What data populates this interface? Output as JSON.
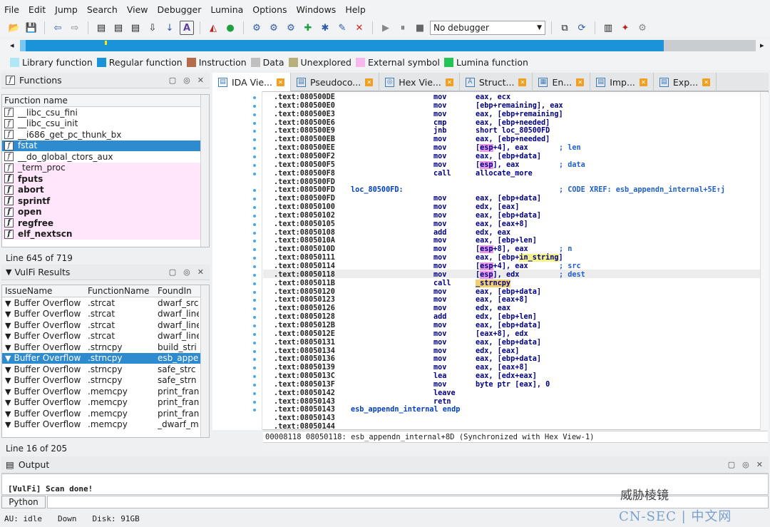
{
  "menu": [
    "File",
    "Edit",
    "Jump",
    "Search",
    "View",
    "Debugger",
    "Lumina",
    "Options",
    "Windows",
    "Help"
  ],
  "toolbar": {
    "debugger_label": "No debugger"
  },
  "legend": [
    {
      "label": "Library function",
      "color": "#aee8f6"
    },
    {
      "label": "Regular function",
      "color": "#1a93d8"
    },
    {
      "label": "Instruction",
      "color": "#b36b4a"
    },
    {
      "label": "Data",
      "color": "#c0c0c0"
    },
    {
      "label": "Unexplored",
      "color": "#b8b07a"
    },
    {
      "label": "External symbol",
      "color": "#f7b8ee"
    },
    {
      "label": "Lumina function",
      "color": "#22c455"
    }
  ],
  "functions": {
    "title": "Functions",
    "col": "Function name",
    "items": [
      "__libc_csu_fini",
      "__libc_csu_init",
      "__i686_get_pc_thunk_bx",
      "fstat",
      "__do_global_ctors_aux",
      "_term_proc",
      "fputs",
      "abort",
      "sprintf",
      "open",
      "regfree",
      "elf_nextscn"
    ],
    "status": "Line 645 of 719"
  },
  "vulfi": {
    "title": "VulFi Results",
    "cols": [
      "IssueName",
      "FunctionName",
      "FoundIn"
    ],
    "rows": [
      [
        "Buffer Overflow",
        ".strcat",
        "dwarf_src"
      ],
      [
        "Buffer Overflow",
        ".strcat",
        "dwarf_line"
      ],
      [
        "Buffer Overflow",
        ".strcat",
        "dwarf_line"
      ],
      [
        "Buffer Overflow",
        ".strcat",
        "dwarf_line"
      ],
      [
        "Buffer Overflow",
        ".strncpy",
        "build_stri"
      ],
      [
        "Buffer Overflow",
        ".strncpy",
        "esb_appe"
      ],
      [
        "Buffer Overflow",
        ".strncpy",
        "safe_strc"
      ],
      [
        "Buffer Overflow",
        ".strncpy",
        "safe_strn"
      ],
      [
        "Buffer Overflow",
        ".memcpy",
        "print_fran"
      ],
      [
        "Buffer Overflow",
        ".memcpy",
        "print_fran"
      ],
      [
        "Buffer Overflow",
        ".memcpy",
        "print_fran"
      ],
      [
        "Buffer Overflow",
        ".memcpy",
        "_dwarf_m"
      ]
    ],
    "status": "Line 16 of 205"
  },
  "tabs": [
    "IDA Vie...",
    "Pseudoco...",
    "Hex Vie...",
    "Struct...",
    "En...",
    "Imp...",
    "Exp..."
  ],
  "code": [
    {
      "a": ".text:080500DE",
      "m": "mov",
      "o": "eax, ecx"
    },
    {
      "a": ".text:080500E0",
      "m": "mov",
      "o": "[ebp+remaining], eax"
    },
    {
      "a": ".text:080500E3",
      "m": "mov",
      "o": "eax, [ebp+remaining]"
    },
    {
      "a": ".text:080500E6",
      "m": "cmp",
      "o": "eax, [ebp+needed]"
    },
    {
      "a": ".text:080500E9",
      "m": "jnb",
      "o": "short loc_80500FD"
    },
    {
      "a": ".text:080500EB",
      "m": "mov",
      "o": "eax, [ebp+needed]"
    },
    {
      "a": ".text:080500EE",
      "m": "mov",
      "o": "[esp+4], eax",
      "c": "; len"
    },
    {
      "a": ".text:080500F2",
      "m": "mov",
      "o": "eax, [ebp+data]"
    },
    {
      "a": ".text:080500F5",
      "m": "mov",
      "o": "[esp], eax",
      "c": "; data"
    },
    {
      "a": ".text:080500F8",
      "m": "call",
      "o": "allocate_more"
    },
    {
      "a": ".text:080500FD",
      "m": "",
      "o": ""
    },
    {
      "a": ".text:080500FD",
      "l": "loc_80500FD:",
      "m": "",
      "o": "",
      "c": "; CODE XREF: esb_appendn_internal+5E↑j"
    },
    {
      "a": ".text:080500FD",
      "m": "mov",
      "o": "eax, [ebp+data]"
    },
    {
      "a": ".text:08050100",
      "m": "mov",
      "o": "edx, [eax]"
    },
    {
      "a": ".text:08050102",
      "m": "mov",
      "o": "eax, [ebp+data]"
    },
    {
      "a": ".text:08050105",
      "m": "mov",
      "o": "eax, [eax+8]"
    },
    {
      "a": ".text:08050108",
      "m": "add",
      "o": "edx, eax"
    },
    {
      "a": ".text:0805010A",
      "m": "mov",
      "o": "eax, [ebp+len]"
    },
    {
      "a": ".text:0805010D",
      "m": "mov",
      "o": "[esp+8], eax",
      "c": "; n"
    },
    {
      "a": ".text:08050111",
      "m": "mov",
      "o": "eax, [ebp+in_string]"
    },
    {
      "a": ".text:08050114",
      "m": "mov",
      "o": "[esp+4], eax",
      "c": "; src"
    },
    {
      "a": ".text:08050118",
      "m": "mov",
      "o": "[esp], edx",
      "c": "; dest"
    },
    {
      "a": ".text:0805011B",
      "m": "call",
      "o": "_strncpy"
    },
    {
      "a": ".text:08050120",
      "m": "mov",
      "o": "eax, [ebp+data]"
    },
    {
      "a": ".text:08050123",
      "m": "mov",
      "o": "eax, [eax+8]"
    },
    {
      "a": ".text:08050126",
      "m": "mov",
      "o": "edx, eax"
    },
    {
      "a": ".text:08050128",
      "m": "add",
      "o": "edx, [ebp+len]"
    },
    {
      "a": ".text:0805012B",
      "m": "mov",
      "o": "eax, [ebp+data]"
    },
    {
      "a": ".text:0805012E",
      "m": "mov",
      "o": "[eax+8], edx"
    },
    {
      "a": ".text:08050131",
      "m": "mov",
      "o": "eax, [ebp+data]"
    },
    {
      "a": ".text:08050134",
      "m": "mov",
      "o": "edx, [eax]"
    },
    {
      "a": ".text:08050136",
      "m": "mov",
      "o": "eax, [ebp+data]"
    },
    {
      "a": ".text:08050139",
      "m": "mov",
      "o": "eax, [eax+8]"
    },
    {
      "a": ".text:0805013C",
      "m": "lea",
      "o": "eax, [edx+eax]"
    },
    {
      "a": ".text:0805013F",
      "m": "mov",
      "o": "byte ptr [eax], 0"
    },
    {
      "a": ".text:08050142",
      "m": "leave",
      "o": ""
    },
    {
      "a": ".text:08050143",
      "m": "retn",
      "o": ""
    },
    {
      "a": ".text:08050143",
      "l": "esb_appendn_internal endp",
      "m": "",
      "o": ""
    },
    {
      "a": ".text:08050143",
      "m": "",
      "o": ""
    },
    {
      "a": ".text:08050144",
      "m": "",
      "o": ""
    }
  ],
  "synced": "00008118 08050118: esb_appendn_internal+8D (Synchronized with Hex View-1)",
  "output": {
    "title": "Output",
    "text": "[VulFi] Scan done!",
    "python": "Python"
  },
  "status": {
    "au": "AU:  idle",
    "dir": "Down",
    "disk": "Disk: 91GB"
  },
  "watermark": {
    "line1": "威胁棱镜",
    "line2": "CN-SEC | 中文网"
  }
}
